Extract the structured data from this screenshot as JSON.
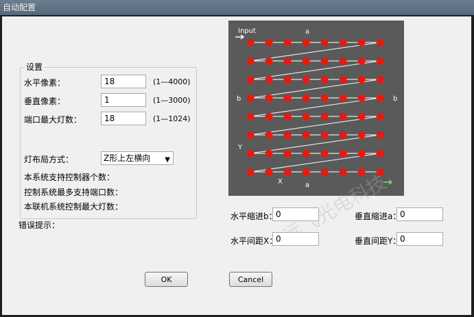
{
  "window": {
    "title": "自动配置"
  },
  "settings": {
    "group_title": "设置",
    "horizontal_pixels": {
      "label": "水平像素：",
      "value": "18",
      "range": "(1—4000)"
    },
    "vertical_pixels": {
      "label": "垂直像素：",
      "value": "1",
      "range": "(1—3000)"
    },
    "port_max_lights": {
      "label": "端口最大灯数：",
      "value": "18",
      "range": "(1—1024)"
    },
    "layout_mode": {
      "label": "灯布局方式：",
      "selected": "Z形上左横向"
    },
    "info1": "本系统支持控制器个数：",
    "info2": "控制系统最多支持端口数：",
    "info3": "本联机系统控制最大灯数："
  },
  "error_label": "错误提示：",
  "diagram": {
    "input_label": "Input",
    "a_top": "a",
    "a_bottom": "a",
    "b_left": "b",
    "b_right": "b",
    "y_label": "Y",
    "x_label": "X"
  },
  "indent_fields": {
    "h_indent": {
      "label": "水平缩进b：",
      "value": "0"
    },
    "v_indent": {
      "label": "垂直缩进a：",
      "value": "0"
    },
    "h_spacing": {
      "label": "水平间距X：",
      "value": "0"
    },
    "v_spacing": {
      "label": "垂直间距Y：",
      "value": "0"
    }
  },
  "buttons": {
    "ok": "OK",
    "cancel": "Cancel"
  },
  "watermark": "远飞光电科技"
}
